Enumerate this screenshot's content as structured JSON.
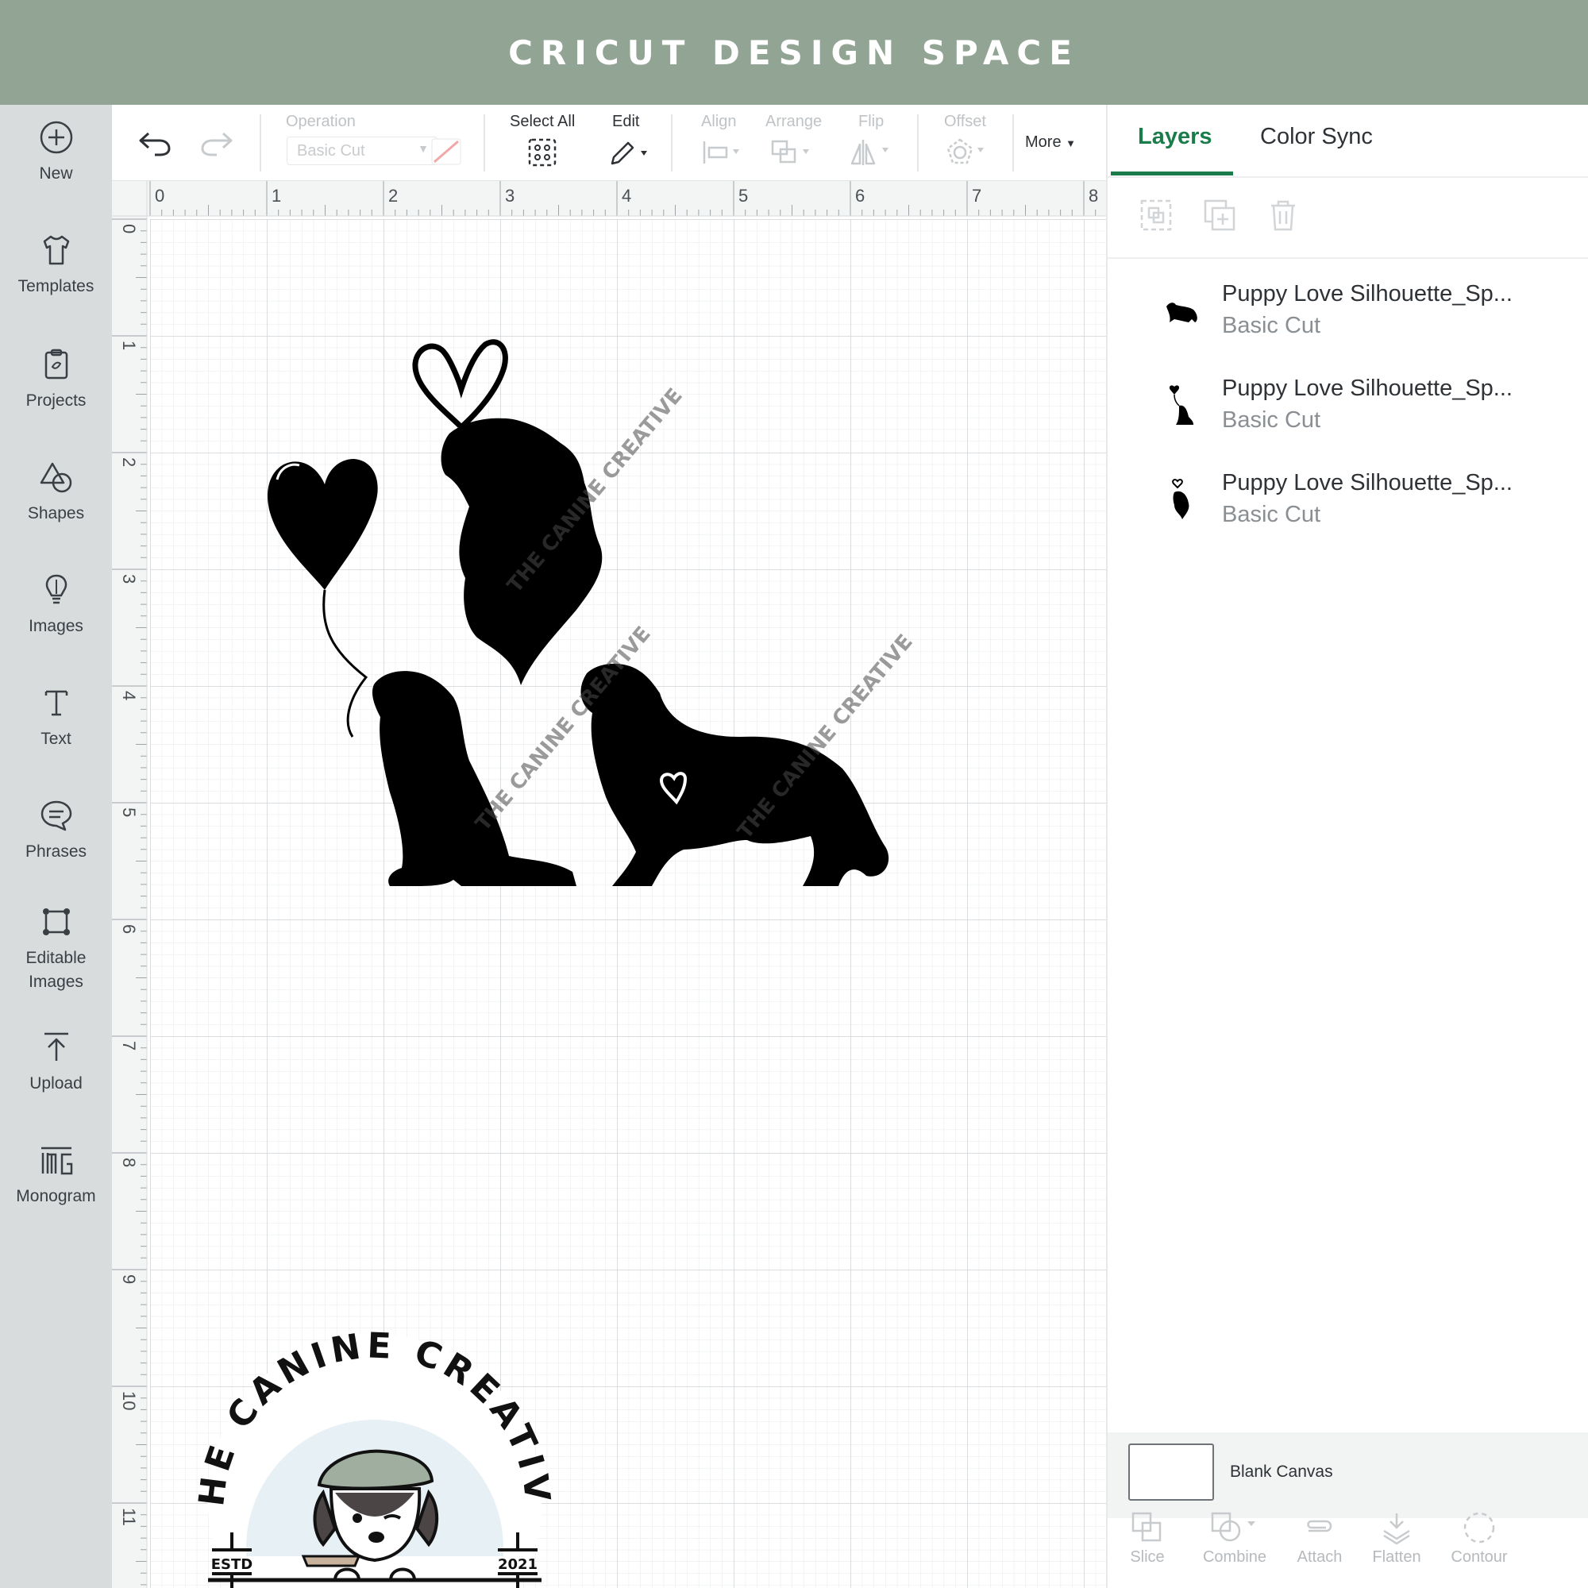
{
  "banner": {
    "title": "CRICUT DESIGN SPACE"
  },
  "sidebar": {
    "items": [
      {
        "label": "New",
        "icon": "plus-circle-icon"
      },
      {
        "label": "Templates",
        "icon": "shirt-icon"
      },
      {
        "label": "Projects",
        "icon": "clipboard-icon"
      },
      {
        "label": "Shapes",
        "icon": "shapes-icon"
      },
      {
        "label": "Images",
        "icon": "lightbulb-icon"
      },
      {
        "label": "Text",
        "icon": "text-icon"
      },
      {
        "label": "Phrases",
        "icon": "speech-bubble-icon"
      },
      {
        "label": "Editable\nImages",
        "label_line1": "Editable",
        "label_line2": "Images",
        "icon": "editable-image-icon"
      },
      {
        "label": "Upload",
        "icon": "upload-icon"
      },
      {
        "label": "Monogram",
        "icon": "monogram-icon"
      }
    ]
  },
  "toolbar": {
    "operation_label": "Operation",
    "operation_value": "Basic Cut",
    "select_all_label": "Select All",
    "edit_label": "Edit",
    "align_label": "Align",
    "arrange_label": "Arrange",
    "flip_label": "Flip",
    "offset_label": "Offset",
    "more_label": "More"
  },
  "ruler": {
    "x_ticks": [
      "0",
      "1",
      "2",
      "3",
      "4",
      "5",
      "6",
      "7",
      "8"
    ],
    "y_ticks": [
      "0",
      "1",
      "2",
      "3",
      "4",
      "5",
      "6",
      "7",
      "8",
      "9",
      "10",
      "11"
    ]
  },
  "watermark_text": "THE CANINE CREATIVE",
  "layers_panel": {
    "tabs": [
      {
        "label": "Layers",
        "active": true
      },
      {
        "label": "Color Sync",
        "active": false
      }
    ],
    "layers": [
      {
        "name": "Puppy Love Silhouette_Sp...",
        "operation": "Basic Cut"
      },
      {
        "name": "Puppy Love Silhouette_Sp...",
        "operation": "Basic Cut"
      },
      {
        "name": "Puppy Love Silhouette_Sp...",
        "operation": "Basic Cut"
      }
    ],
    "blank_canvas_label": "Blank Canvas",
    "bottom_tools": [
      "Slice",
      "Combine",
      "Attach",
      "Flatten",
      "Contour"
    ]
  },
  "logo": {
    "text": "THE CANINE CREATIVE",
    "estd": "ESTD",
    "year": "2021"
  },
  "colors": {
    "banner": "#92a494",
    "accent_green": "#1b7c4b",
    "sidebar": "#d9dcdc"
  }
}
